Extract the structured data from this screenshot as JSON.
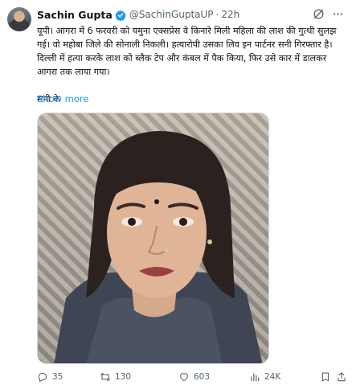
{
  "tweet": {
    "author_name": "Sachin Gupta",
    "handle": "@SachinGuptaUP",
    "separator": "·",
    "time": "22h",
    "text_lines": [
      "यूपी। आगरा में 6 फरवरी को यमुना एक्सप्रेस वे किनारे मिली महिला की लाश की गुत्थी सुलझ",
      "गई। वो महोबा जिले की सोनाली निकली। हत्यारोपी उसका लिव इन पार्टनर सनी गिरफ्तार है।",
      "दिल्ली में हत्या करके लाश को ब्लैक टेप और कंबल में पैक किया, फिर उसे कार में डालकर",
      "आगरा तक लाया गया।"
    ],
    "text_tail": "सनी के",
    "show_more": "Show more"
  },
  "actions": {
    "replies": "35",
    "reposts": "130",
    "likes": "603",
    "views": "24K"
  },
  "colors": {
    "accent": "#1d9bf0",
    "secondary_text": "#536471",
    "primary_text": "#0f1419"
  },
  "icons": [
    "verified-badge-icon",
    "grok-icon",
    "more-icon",
    "reply-icon",
    "repost-icon",
    "like-icon",
    "views-icon",
    "bookmark-icon",
    "share-icon"
  ]
}
